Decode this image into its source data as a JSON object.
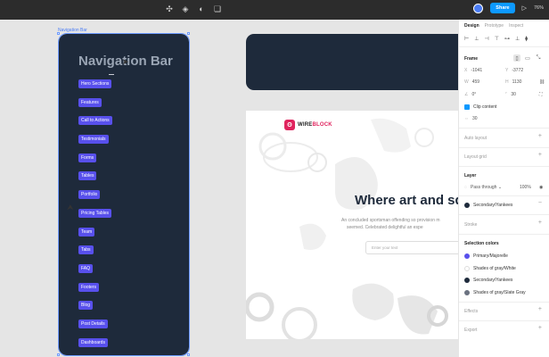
{
  "toolbar": {
    "share_label": "Share",
    "zoom_label": "76%"
  },
  "canvas": {
    "frame_label": "Navigation Bar",
    "nav": {
      "title": "Navigation Bar",
      "items": [
        "Hero Sections",
        "Features",
        "Call to Actions",
        "Testimonials",
        "Forms",
        "Tables",
        "Portfolio",
        "Pricing Tables",
        "Team",
        "Tabs",
        "FAQ",
        "Footers",
        "Blog",
        "Post Details",
        "Dashboards"
      ]
    },
    "hero": {
      "logo_text_a": "WIRE",
      "logo_text_b": "BLOCK",
      "heading": "Where art and sq",
      "sub_line1": "An concluded sportsman offending so provision m",
      "sub_line2": "seemed. Celebrated delightful an espe",
      "input_placeholder": "Enter your text"
    }
  },
  "panel": {
    "tabs": [
      "Design",
      "Prototype",
      "Inspect"
    ],
    "frame": {
      "title": "Frame",
      "x": "-1041",
      "y": "-3772",
      "w": "459",
      "h": "1130",
      "rotation": "0°",
      "radius": "30",
      "clip_label": "Clip content",
      "spacing": "30"
    },
    "auto_layout": "Auto layout",
    "layout_grid": "Layout grid",
    "layer": {
      "title": "Layer",
      "blend": "Pass through",
      "opacity": "100%"
    },
    "fill_name": "Secondary/Yankees",
    "stroke": "Stroke",
    "selection_colors": {
      "title": "Selection colors",
      "items": [
        {
          "name": "Primary/Majorelle",
          "color": "#5850ec"
        },
        {
          "name": "Shades of gray/White",
          "color": "#ffffff"
        },
        {
          "name": "Secondary/Yankees",
          "color": "#1e2a3b"
        },
        {
          "name": "Shades of gray/Slate Gray",
          "color": "#6b7280"
        }
      ]
    },
    "effects": "Effects",
    "export": "Export"
  }
}
